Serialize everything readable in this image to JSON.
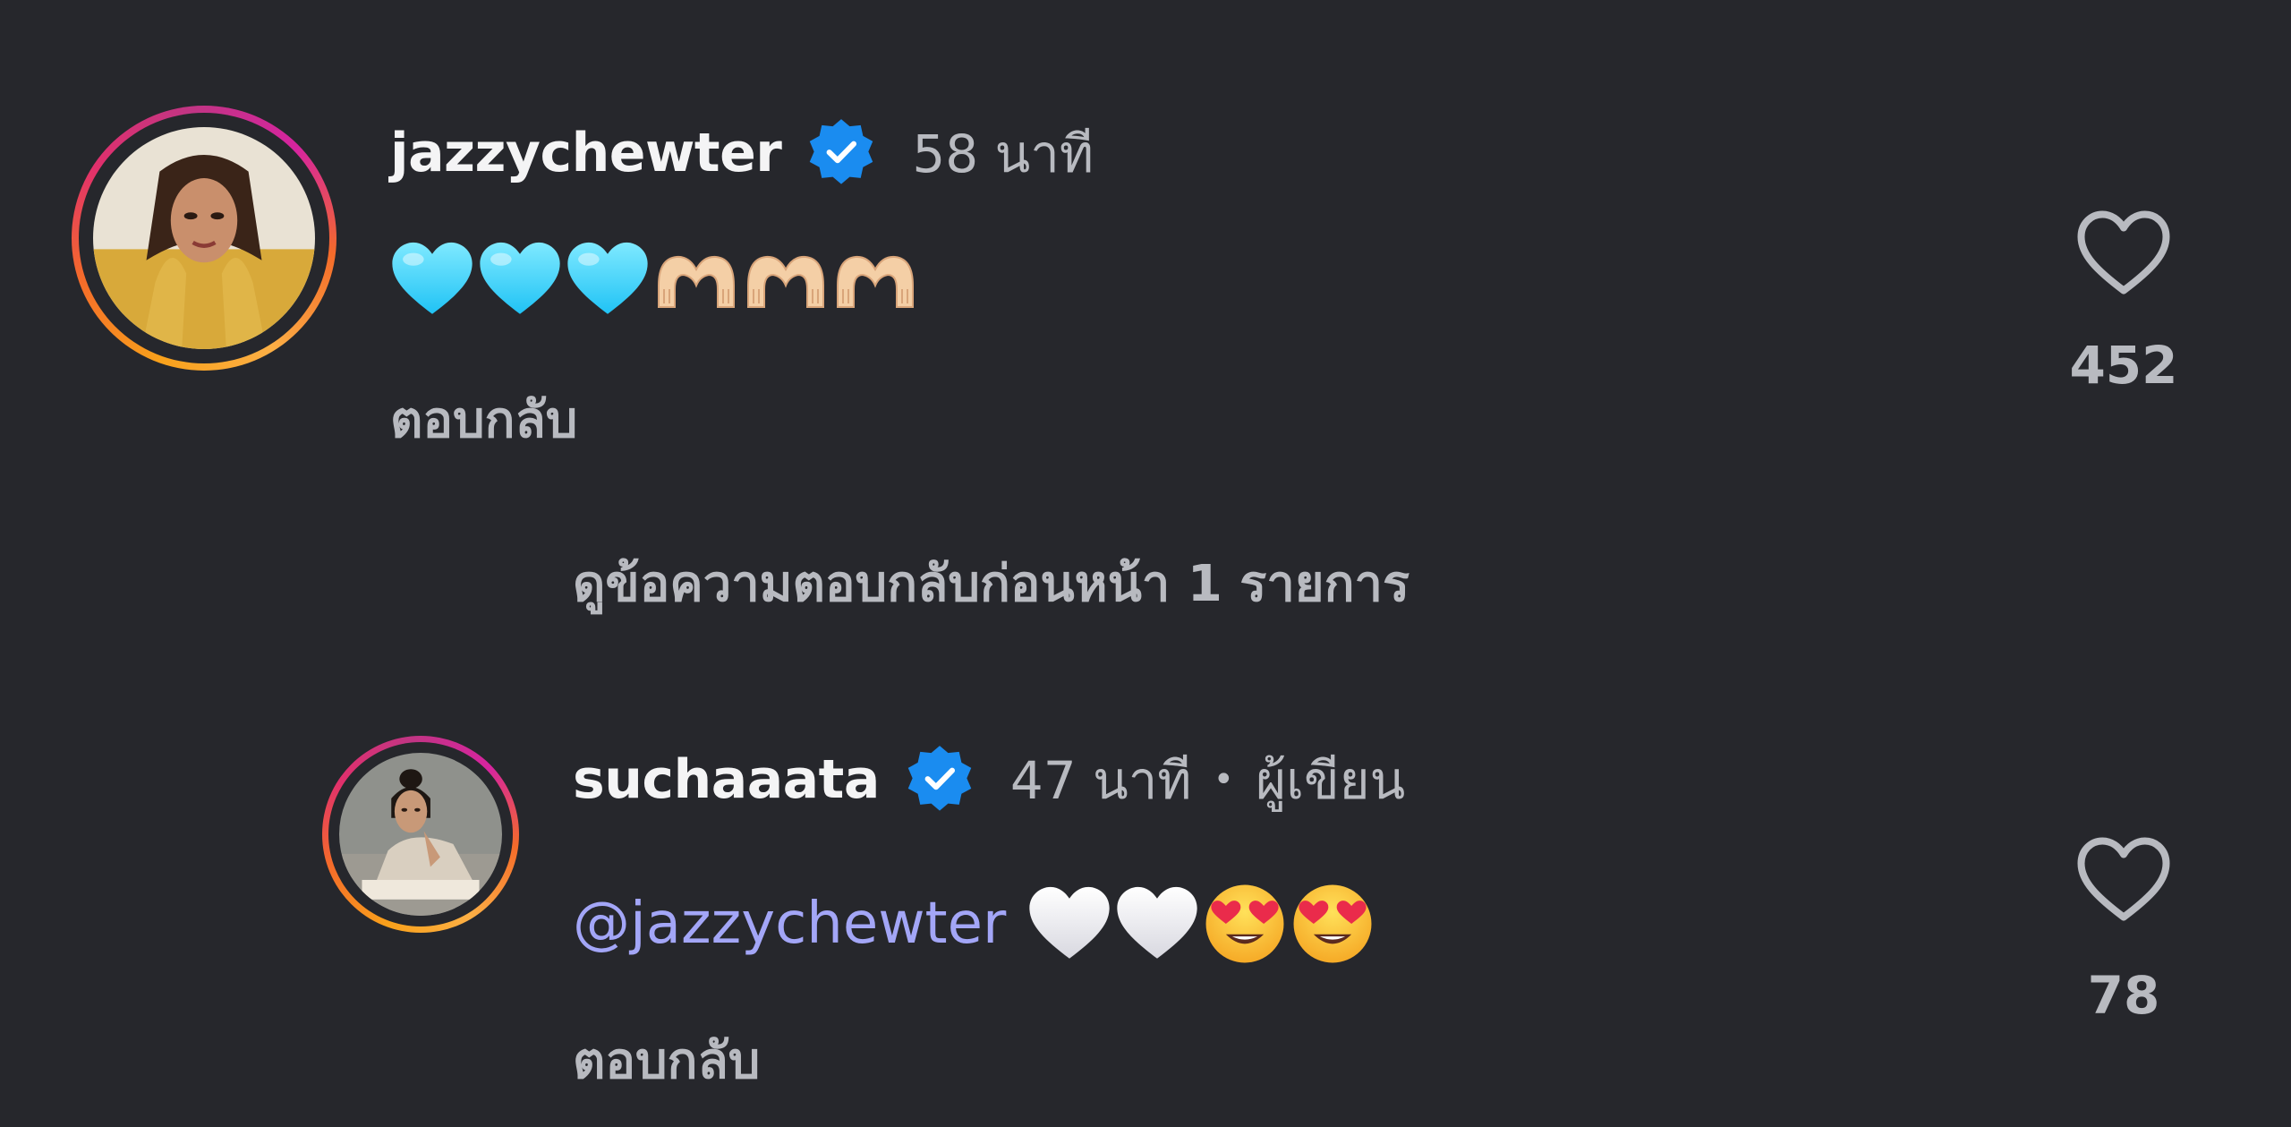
{
  "colors": {
    "background": "#26272c",
    "username": "#f4f4f5",
    "secondary_text": "#b8bac0",
    "mention": "#a3a6f7",
    "verified_badge": "#1a8cf0"
  },
  "comments": [
    {
      "username": "jazzychewter",
      "verified": true,
      "timestamp": "58 นาที",
      "body_emoji": [
        "light-blue-heart",
        "light-blue-heart",
        "light-blue-heart",
        "heart-hands",
        "heart-hands",
        "heart-hands"
      ],
      "reply_label": "ตอบกลับ",
      "like_count": "452",
      "like_icon": "heart-outline-icon"
    }
  ],
  "view_previous_replies": "ดูข้อความตอบกลับก่อนหน้า 1 รายการ",
  "replies": [
    {
      "username": "suchaaata",
      "verified": true,
      "timestamp": "47 นาที",
      "separator": "•",
      "author_tag": "ผู้เขียน",
      "mention": "@jazzychewter",
      "body_emoji": [
        "white-heart",
        "white-heart",
        "heart-eyes",
        "heart-eyes"
      ],
      "reply_label": "ตอบกลับ",
      "like_count": "78",
      "like_icon": "heart-outline-icon"
    }
  ]
}
